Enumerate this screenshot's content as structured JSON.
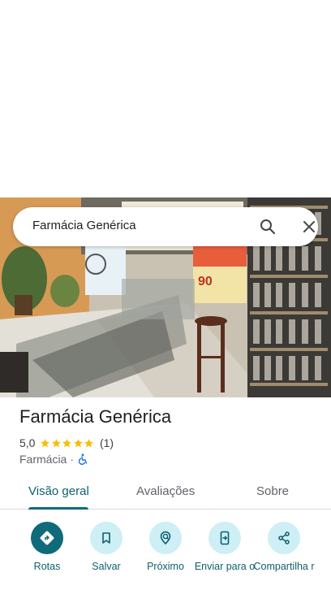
{
  "search": {
    "query": "Farmácia Genérica"
  },
  "place": {
    "title": "Farmácia Genérica",
    "rating": "5,0",
    "review_count": "(1)",
    "stars": 5,
    "category": "Farmácia",
    "separator": "·"
  },
  "tabs": [
    {
      "label": "Visão geral",
      "active": true
    },
    {
      "label": "Avaliações",
      "active": false
    },
    {
      "label": "Sobre",
      "active": false
    }
  ],
  "actions": [
    {
      "label": "Rotas",
      "icon": "directions-icon"
    },
    {
      "label": "Salvar",
      "icon": "bookmark-icon"
    },
    {
      "label": "Próximo",
      "icon": "nearby-icon"
    },
    {
      "label": "Enviar para o",
      "icon": "send-to-phone-icon"
    },
    {
      "label": "Compartilha r",
      "icon": "share-icon"
    }
  ],
  "colors": {
    "accent": "#0f6b7a",
    "accent_light": "#cdeff5",
    "star": "#fbbc04",
    "wheelchair": "#1a73e8"
  }
}
